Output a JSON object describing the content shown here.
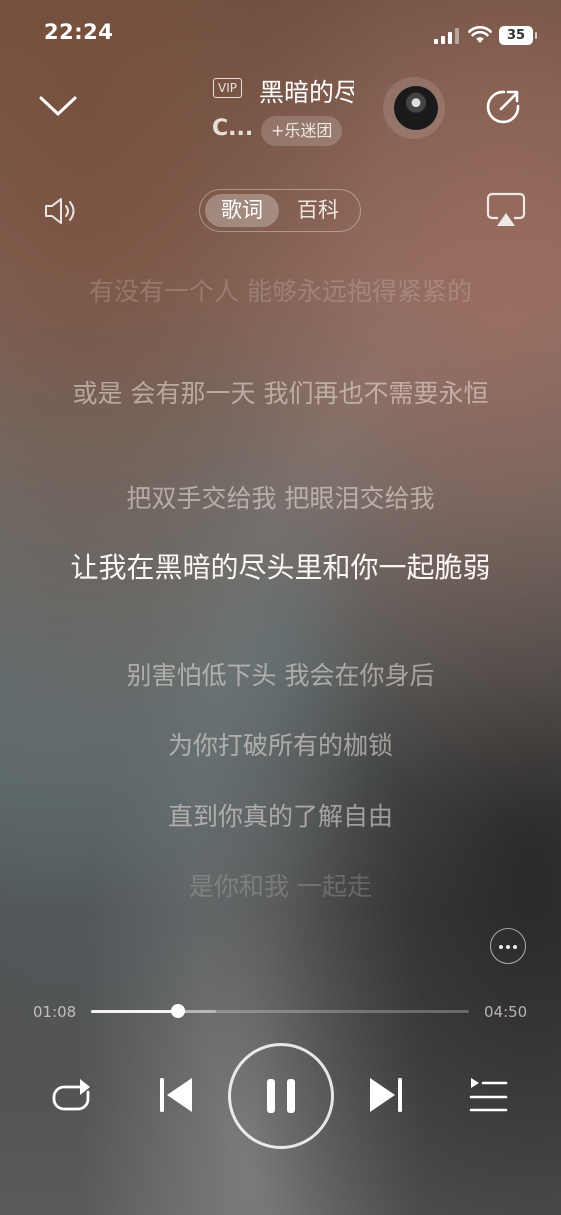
{
  "status_bar": {
    "time": "22:24",
    "battery": "35"
  },
  "header": {
    "vip_badge": "VIP",
    "song_title": "黑暗的尽头",
    "artist": "C...",
    "fan_club_button": "+乐迷团"
  },
  "tabs": {
    "lyrics": "歌词",
    "wiki": "百科",
    "selected": "歌词"
  },
  "lyrics": [
    {
      "text": "有没有一个人 能够永远抱得紧紧的",
      "state": "faded"
    },
    {
      "text": "或是 会有那一天 我们再也不需要永恒",
      "state": "normal"
    },
    {
      "text": "把双手交给我 把眼泪交给我",
      "state": "normal"
    },
    {
      "text": "让我在黑暗的尽头里和你一起脆弱",
      "state": "active"
    },
    {
      "text": "别害怕低下头 我会在你身后",
      "state": "normal"
    },
    {
      "text": "为你打破所有的枷锁",
      "state": "normal"
    },
    {
      "text": "直到你真的了解自由",
      "state": "normal"
    },
    {
      "text": "是你和我 一起走",
      "state": "faded"
    }
  ],
  "player": {
    "current_time": "01:08",
    "total_time": "04:50",
    "progress": 0.23,
    "buffered": 0.33,
    "state": "playing"
  },
  "icons": {
    "collapse": "chevron-down-icon",
    "share": "share-icon",
    "volume": "volume-icon",
    "cast": "airplay-icon",
    "more": "more-icon",
    "repeat": "repeat-icon",
    "previous": "previous-icon",
    "pause": "pause-icon",
    "next": "next-icon",
    "playlist": "playlist-icon"
  }
}
